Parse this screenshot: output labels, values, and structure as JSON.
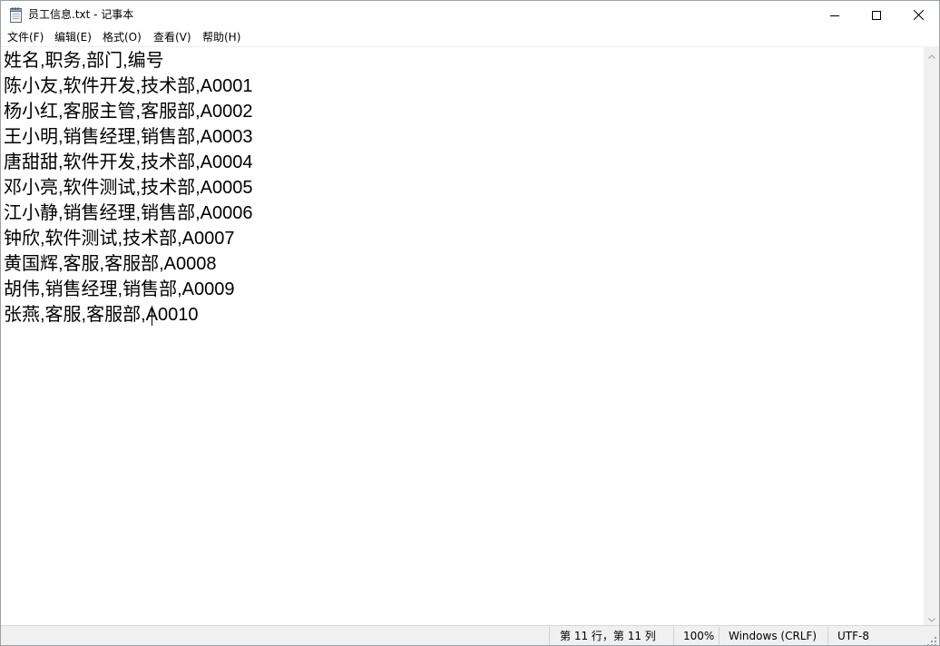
{
  "window": {
    "title": "员工信息.txt - 记事本",
    "app_icon": "notepad-icon",
    "controls": {
      "minimize_icon": "minimize-icon",
      "maximize_icon": "maximize-icon",
      "close_icon": "close-icon"
    }
  },
  "menu": {
    "items": [
      {
        "label": "文件(F)"
      },
      {
        "label": "编辑(E)"
      },
      {
        "label": "格式(O)"
      },
      {
        "label": "查看(V)"
      },
      {
        "label": "帮助(H)"
      }
    ]
  },
  "editor": {
    "lines": [
      "姓名,职务,部门,编号",
      "陈小友,软件开发,技术部,A0001",
      "杨小红,客服主管,客服部,A0002",
      "王小明,销售经理,销售部,A0003",
      "唐甜甜,软件开发,技术部,A0004",
      "邓小亮,软件测试,技术部,A0005",
      "江小静,销售经理,销售部,A0006",
      "钟欣,软件测试,技术部,A0007",
      "黄国辉,客服,客服部,A0008",
      "胡伟,销售经理,销售部,A0009",
      "张燕,客服,客服部,A0010"
    ]
  },
  "statusbar": {
    "position": "第 11 行，第 11 列",
    "zoom": "100%",
    "line_ending": "Windows (CRLF)",
    "encoding": "UTF-8"
  }
}
